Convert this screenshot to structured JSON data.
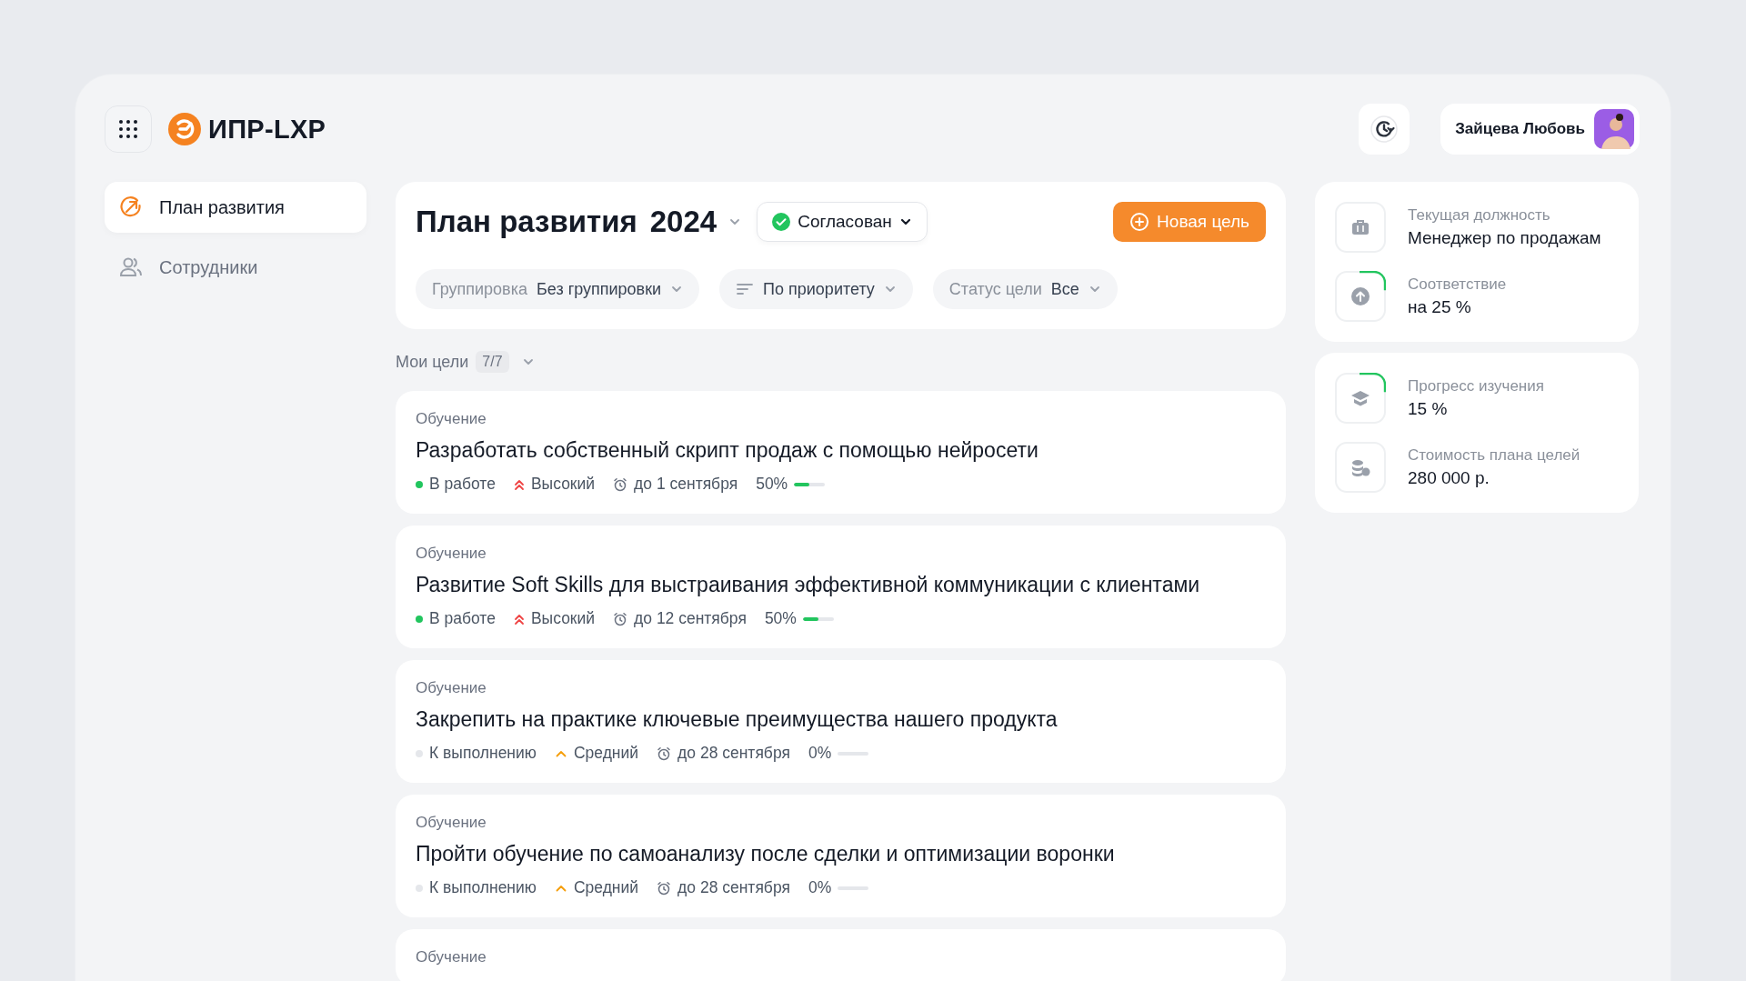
{
  "app": {
    "logo_text": "ИПР-LXP"
  },
  "user": {
    "name": "Зайцева Любовь"
  },
  "sidebar": {
    "items": [
      {
        "label": "План развития",
        "kind": "plan",
        "selected": true
      },
      {
        "label": "Сотрудники",
        "kind": "people",
        "selected": false
      }
    ]
  },
  "plan": {
    "title": "План развития",
    "year": "2024",
    "status": "Согласован",
    "new_button": "Новая цель",
    "filters": [
      {
        "kind": "labeled",
        "label": "Группировка",
        "value": "Без группировки"
      },
      {
        "kind": "sort",
        "value": "По приоритету"
      },
      {
        "kind": "labeled",
        "label": "Статус цели",
        "value": "Все"
      }
    ]
  },
  "goals_section": {
    "title": "Мои цели",
    "count": "7/7"
  },
  "goals": [
    {
      "category": "Обучение",
      "title": "Разработать собственный скрипт продаж с помощью нейросети",
      "status": "В работе",
      "color": "#22c55e",
      "priority": "Высокий",
      "kind": "high",
      "deadline": "до 1 сентября",
      "percent": "50%",
      "level": 0.5
    },
    {
      "category": "Обучение",
      "title": "Развитие Soft Skills для выстраивания эффективной коммуникации с клиентами",
      "status": "В работе",
      "color": "#22c55e",
      "priority": "Высокий",
      "kind": "high",
      "deadline": "до 12 сентября",
      "percent": "50%",
      "level": 0.5
    },
    {
      "category": "Обучение",
      "title": "Закрепить на практике ключевые преимущества нашего продукта",
      "status": "К выполнению",
      "color": "#e5e7eb",
      "priority": "Средний",
      "kind": "medium",
      "deadline": "до 28 сентября",
      "percent": "0%"
    },
    {
      "category": "Обучение",
      "title": "Пройти обучение по самоанализу после сделки и оптимизации воронки",
      "status": "К выполнению",
      "color": "#e5e7eb",
      "priority": "Средний",
      "kind": "medium",
      "deadline": "до 28 сентября",
      "percent": "0%"
    },
    {
      "category": "Обучение"
    }
  ],
  "info_cards": [
    {
      "items": [
        {
          "kind": "position",
          "label": "Текущая должность",
          "value": "Менеджер по продажам"
        },
        {
          "kind": "match",
          "label": "Соответствие",
          "value": "на 25 %"
        }
      ]
    },
    {
      "items": [
        {
          "kind": "learning",
          "label": "Прогресс изучения",
          "value": "15 %"
        },
        {
          "kind": "cost",
          "label": "Стоимость плана целей",
          "value": "280 000 р."
        }
      ]
    }
  ]
}
